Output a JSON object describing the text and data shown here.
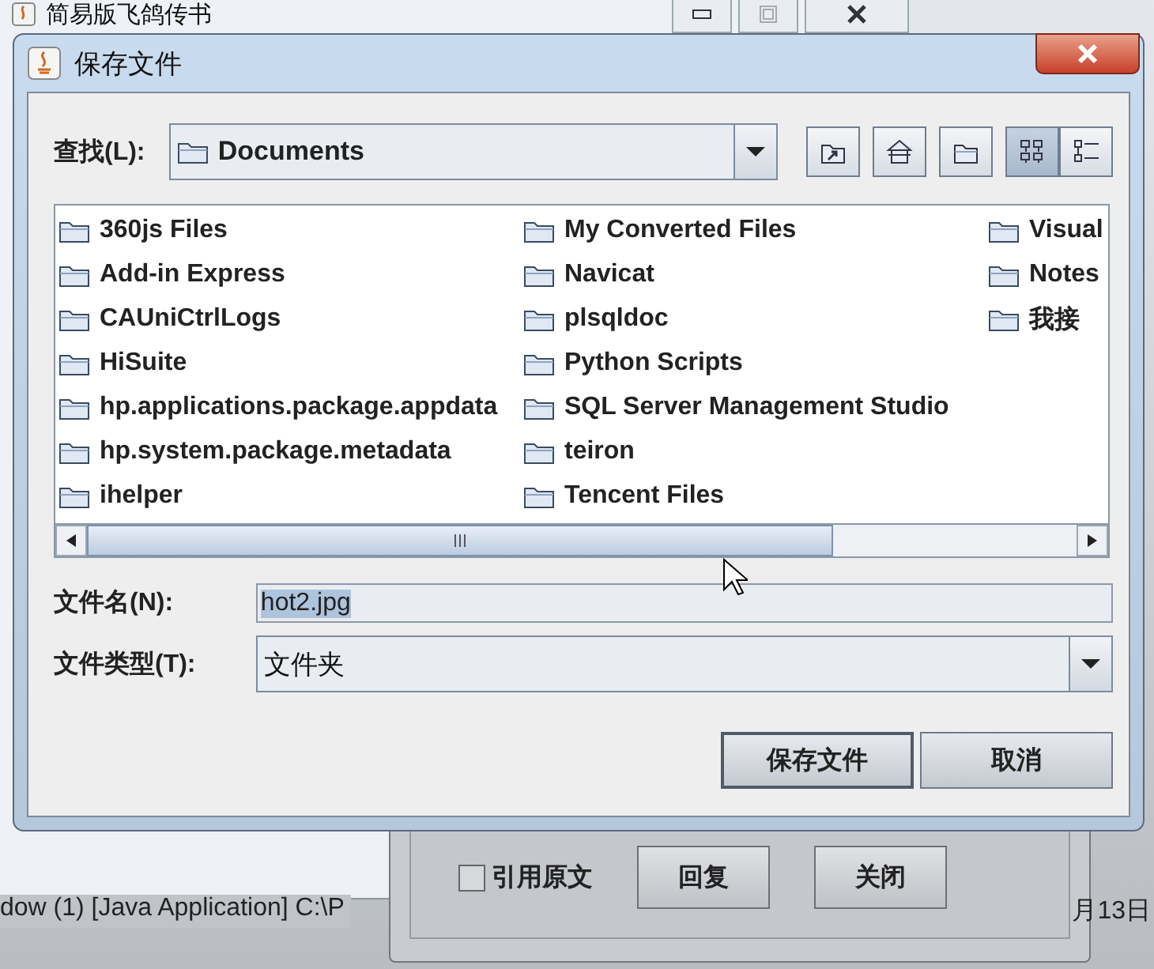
{
  "background_window": {
    "title": "简易版飞鸽传书"
  },
  "dialog": {
    "title": "保存文件",
    "look_in": {
      "label": "查找(L):",
      "value": "Documents"
    },
    "toolbar": [
      {
        "kind": "up",
        "selected": false
      },
      {
        "kind": "home",
        "selected": false
      },
      {
        "kind": "new-folder",
        "selected": false
      },
      {
        "kind": "list",
        "selected": true
      },
      {
        "kind": "details",
        "selected": false
      }
    ],
    "files": [
      {
        "name": "360js Files"
      },
      {
        "name": "Add-in Express"
      },
      {
        "name": "CAUniCtrlLogs"
      },
      {
        "name": "HiSuite"
      },
      {
        "name": "hp.applications.package.appdata"
      },
      {
        "name": "hp.system.package.metadata"
      },
      {
        "name": "ihelper"
      },
      {
        "name": "My Converted Files"
      },
      {
        "name": "Navicat"
      },
      {
        "name": "plsqldoc"
      },
      {
        "name": "Python Scripts"
      },
      {
        "name": "SQL Server Management Studio"
      },
      {
        "name": "teiron"
      },
      {
        "name": "Tencent Files"
      },
      {
        "name": "Visual"
      },
      {
        "name": "Notes"
      },
      {
        "name": "我接"
      }
    ],
    "file_name": {
      "label": "文件名(N):",
      "value": "hot2.jpg",
      "selected": true
    },
    "file_type": {
      "label": "文件类型(T):",
      "value": "文件夹"
    },
    "buttons": [
      {
        "label": "保存文件",
        "default": true
      },
      {
        "label": "取消",
        "default": false
      }
    ]
  },
  "reply_window": {
    "quote": {
      "label": "引用原文",
      "checked": false
    },
    "buttons": [
      "回复",
      "关闭"
    ]
  },
  "console": {
    "text": "dow (1) [Java Application] C:\\P",
    "date": "月13日"
  }
}
